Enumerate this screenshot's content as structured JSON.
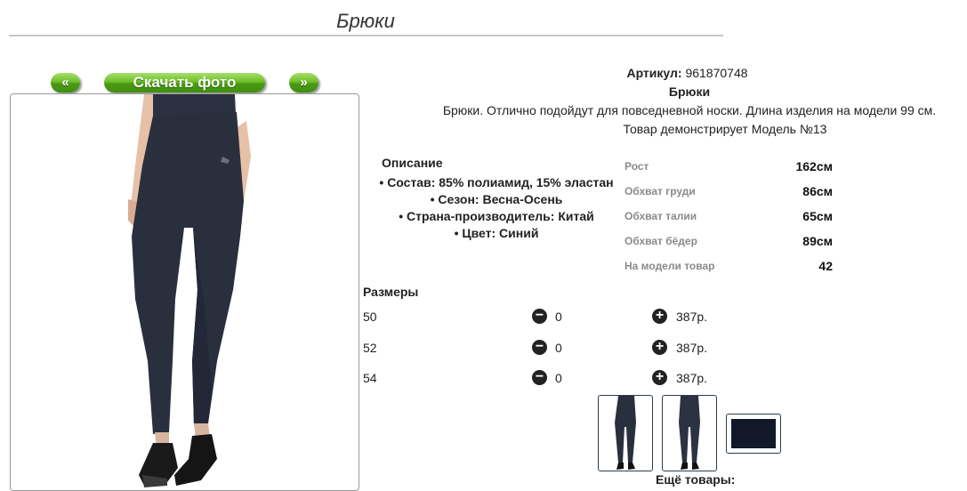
{
  "header": {
    "title": "Брюки"
  },
  "gallery": {
    "prev_label": "«",
    "download_label": "Скачать фото",
    "next_label": "»"
  },
  "product": {
    "article_label": "Артикул:",
    "article_value": "961870748",
    "name": "Брюки",
    "description": "Брюки. Отлично подойдут для повседневной носки. Длина изделия на модели 99 см.",
    "model_line": "Товар демонстрирует Модель №13"
  },
  "description_block": {
    "heading": "Описание",
    "items": [
      "Состав: 85% полиамид, 15% эластан",
      "Сезон: Весна-Осень",
      "Страна-производитель: Китай",
      "Цвет: Синий"
    ]
  },
  "model_measurements": [
    {
      "label": "Рост",
      "value": "162см"
    },
    {
      "label": "Обхват груди",
      "value": "86см"
    },
    {
      "label": "Обхват талии",
      "value": "65см"
    },
    {
      "label": "Обхват бёдер",
      "value": "89см"
    },
    {
      "label": "На модели товар",
      "value": "42"
    }
  ],
  "sizes": {
    "heading": "Размеры",
    "rows": [
      {
        "size": "50",
        "qty": "0",
        "price": "387р."
      },
      {
        "size": "52",
        "qty": "0",
        "price": "387р."
      },
      {
        "size": "54",
        "qty": "0",
        "price": "387р."
      }
    ]
  },
  "more": {
    "label": "Ещё товары:"
  },
  "colors": {
    "accent_green": "#6fbe2a",
    "pants_navy": "#2a2f3d",
    "rule": "#c7c7c7"
  }
}
